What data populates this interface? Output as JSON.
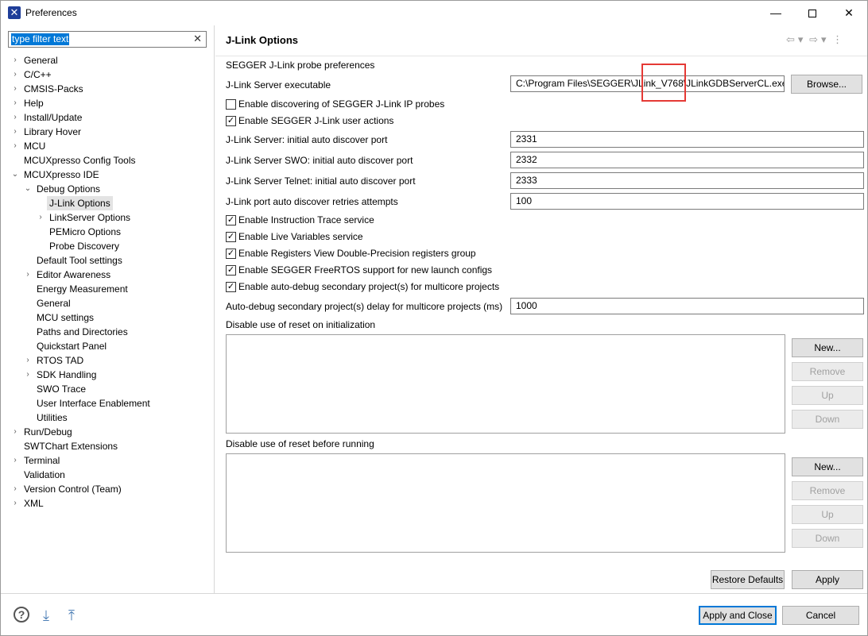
{
  "window": {
    "title": "Preferences",
    "minimize_glyph": "—",
    "close_glyph": "✕"
  },
  "filter": {
    "value": "type filter text",
    "clear_glyph": "✕"
  },
  "tree": {
    "items": [
      {
        "label": "General",
        "expandable": true
      },
      {
        "label": "C/C++",
        "expandable": true
      },
      {
        "label": "CMSIS-Packs",
        "expandable": true
      },
      {
        "label": "Help",
        "expandable": true
      },
      {
        "label": "Install/Update",
        "expandable": true
      },
      {
        "label": "Library Hover",
        "expandable": true
      },
      {
        "label": "MCU",
        "expandable": true
      },
      {
        "label": "MCUXpresso Config Tools",
        "expandable": false
      },
      {
        "label": "MCUXpresso IDE",
        "expandable": true,
        "expanded": true
      },
      {
        "label": "Debug Options",
        "expandable": true,
        "expanded": true
      },
      {
        "label": "J-Link Options",
        "expandable": false,
        "selected": true
      },
      {
        "label": "LinkServer Options",
        "expandable": true
      },
      {
        "label": "PEMicro Options",
        "expandable": false
      },
      {
        "label": "Probe Discovery",
        "expandable": false
      },
      {
        "label": "Default Tool settings",
        "expandable": false
      },
      {
        "label": "Editor Awareness",
        "expandable": true
      },
      {
        "label": "Energy Measurement",
        "expandable": false
      },
      {
        "label": "General",
        "expandable": false
      },
      {
        "label": "MCU settings",
        "expandable": false
      },
      {
        "label": "Paths and Directories",
        "expandable": false
      },
      {
        "label": "Quickstart Panel",
        "expandable": false
      },
      {
        "label": "RTOS TAD",
        "expandable": true
      },
      {
        "label": "SDK Handling",
        "expandable": true
      },
      {
        "label": "SWO Trace",
        "expandable": false
      },
      {
        "label": "User Interface Enablement",
        "expandable": false
      },
      {
        "label": "Utilities",
        "expandable": false
      },
      {
        "label": "Run/Debug",
        "expandable": true
      },
      {
        "label": "SWTChart Extensions",
        "expandable": false
      },
      {
        "label": "Terminal",
        "expandable": true
      },
      {
        "label": "Validation",
        "expandable": false
      },
      {
        "label": "Version Control (Team)",
        "expandable": true
      },
      {
        "label": "XML",
        "expandable": true
      }
    ]
  },
  "page": {
    "title": "J-Link Options",
    "nav": {
      "back": "⇦",
      "back_menu": "▾",
      "forward": "⇨",
      "forward_menu": "▾",
      "more": "⋮"
    },
    "intro": "SEGGER J-Link probe preferences",
    "server_exe_label": "J-Link Server executable",
    "server_exe_value": "C:\\Program Files\\SEGGER\\JLink_V768\\JLinkGDBServerCL.exe",
    "browse_label": "Browse...",
    "checks_top": [
      {
        "label": "Enable discovering of SEGGER J-Link IP probes",
        "checked": false
      },
      {
        "label": "Enable SEGGER J-Link user actions",
        "checked": true
      }
    ],
    "ports": [
      {
        "label": "J-Link Server: initial auto discover port",
        "value": "2331"
      },
      {
        "label": "J-Link Server SWO: initial auto discover port",
        "value": "2332"
      },
      {
        "label": "J-Link Server Telnet: initial auto discover port",
        "value": "2333"
      },
      {
        "label": "J-Link port auto discover retries attempts",
        "value": "100"
      }
    ],
    "checks_bottom": [
      {
        "label": "Enable Instruction Trace service",
        "checked": true
      },
      {
        "label": "Enable Live Variables service",
        "checked": true
      },
      {
        "label": "Enable Registers View Double-Precision registers group",
        "checked": true
      },
      {
        "label": "Enable SEGGER FreeRTOS support for new launch configs",
        "checked": true
      },
      {
        "label": "Enable auto-debug secondary project(s) for multicore projects",
        "checked": true
      }
    ],
    "delay_label": "Auto-debug secondary project(s) delay for multicore projects (ms)",
    "delay_value": "1000",
    "reset_init_label": "Disable use of reset on initialization",
    "reset_run_label": "Disable use of reset before running",
    "list_buttons": {
      "new": "New...",
      "remove": "Remove",
      "up": "Up",
      "down": "Down"
    },
    "restore_defaults": "Restore Defaults",
    "apply": "Apply"
  },
  "bottom": {
    "help_glyph": "?",
    "import_glyph": "⤓",
    "export_glyph": "⤒",
    "apply_close": "Apply and Close",
    "cancel": "Cancel"
  },
  "colors": {
    "accent": "#0078d7",
    "highlight": "#e53935",
    "selection": "#e3e3e3"
  },
  "check_glyph": "✓",
  "arrow_collapsed": "›",
  "arrow_expanded": "⌄"
}
